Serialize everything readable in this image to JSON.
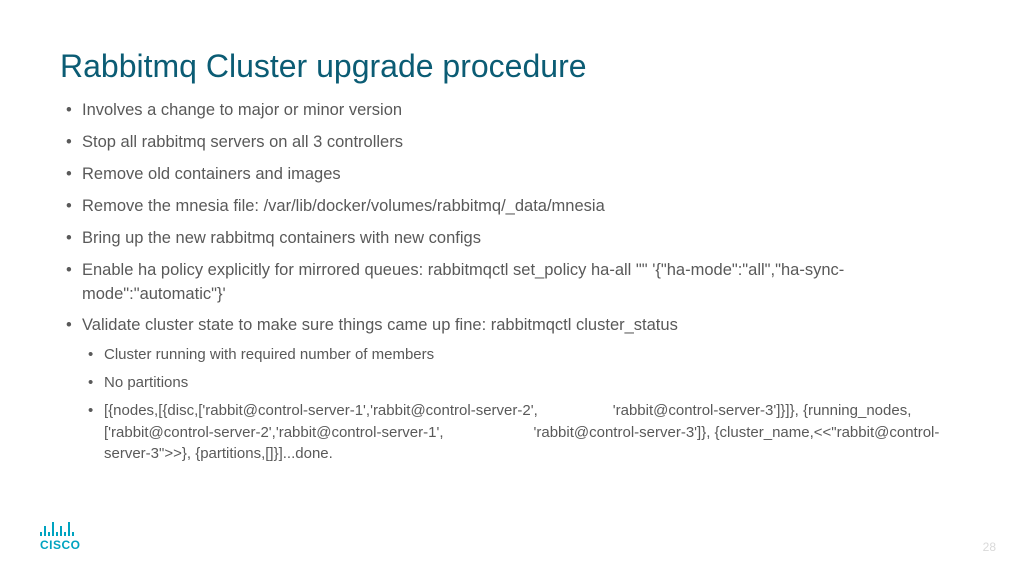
{
  "title": "Rabbitmq Cluster upgrade procedure",
  "bullets": [
    "Involves a change to major or minor version",
    "Stop all rabbitmq servers on all 3 controllers",
    "Remove old containers and images",
    "Remove the mnesia file: /var/lib/docker/volumes/rabbitmq/_data/mnesia",
    "Bring up the new rabbitmq containers with new configs",
    "Enable ha policy explicitly for mirrored queues: rabbitmqctl set_policy ha-all \"\" '{\"ha-mode\":\"all\",\"ha-sync-mode\":\"automatic\"}'",
    "Validate cluster state to make sure things came up fine: rabbitmqctl cluster_status"
  ],
  "subbullets": [
    "Cluster running with required number of members",
    "No partitions",
    "[{nodes,[{disc,['rabbit@control-server-1','rabbit@control-server-2',     'rabbit@control-server-3']}]}, {running_nodes,['rabbit@control-server-2','rabbit@control-server-1',      'rabbit@control-server-3']}, {cluster_name,<<\"rabbit@control-server-3\">>}, {partitions,[]}]...done."
  ],
  "brand": "CISCO",
  "page": "28"
}
